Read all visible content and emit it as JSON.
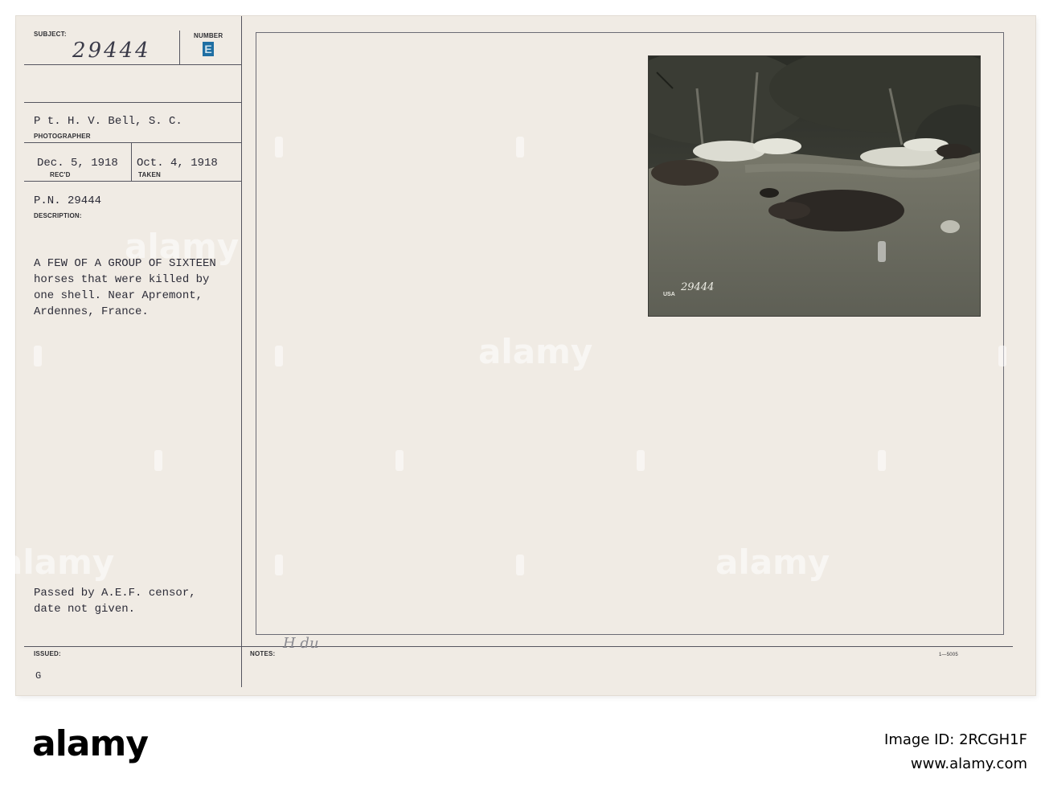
{
  "card": {
    "subject_label": "SUBJECT:",
    "subject_handwritten": "29444",
    "number_label": "NUMBER",
    "number_stamp": "E",
    "photographer_name": "P t. H. V. Bell, S. C.",
    "photographer_label": "PHOTOGRAPHER",
    "received_date": "Dec. 5, 1918",
    "received_label": "REC'D",
    "taken_date": "Oct. 4, 1918",
    "taken_label": "TAKEN",
    "pn": "P.N. 29444",
    "description_label": "DESCRIPTION:",
    "description_lines": [
      "A FEW OF A GROUP OF SIXTEEN",
      "horses that were killed by",
      "one shell. Near Apremont,",
      "Ardennes, France."
    ],
    "censor_lines": [
      "Passed by A.E.F. censor,",
      "date not given."
    ],
    "issued_label": "ISSUED:",
    "issued_value": "G",
    "notes_label": "NOTES:",
    "notes_handwritten": "H du",
    "form_number": "1—5005",
    "photo_stamp": "USA",
    "photo_number": "29444"
  },
  "watermark": {
    "text": "alamy"
  },
  "footer": {
    "logo": "alamy",
    "image_id_label": "Image ID: 2RCGH1F",
    "site": "www.alamy.com"
  },
  "colors": {
    "card_bg": "#f0ebe4",
    "ink": "#2c2c38",
    "stamp_blue": "#1f6fa3",
    "photo_dark": "#4a4a42"
  }
}
